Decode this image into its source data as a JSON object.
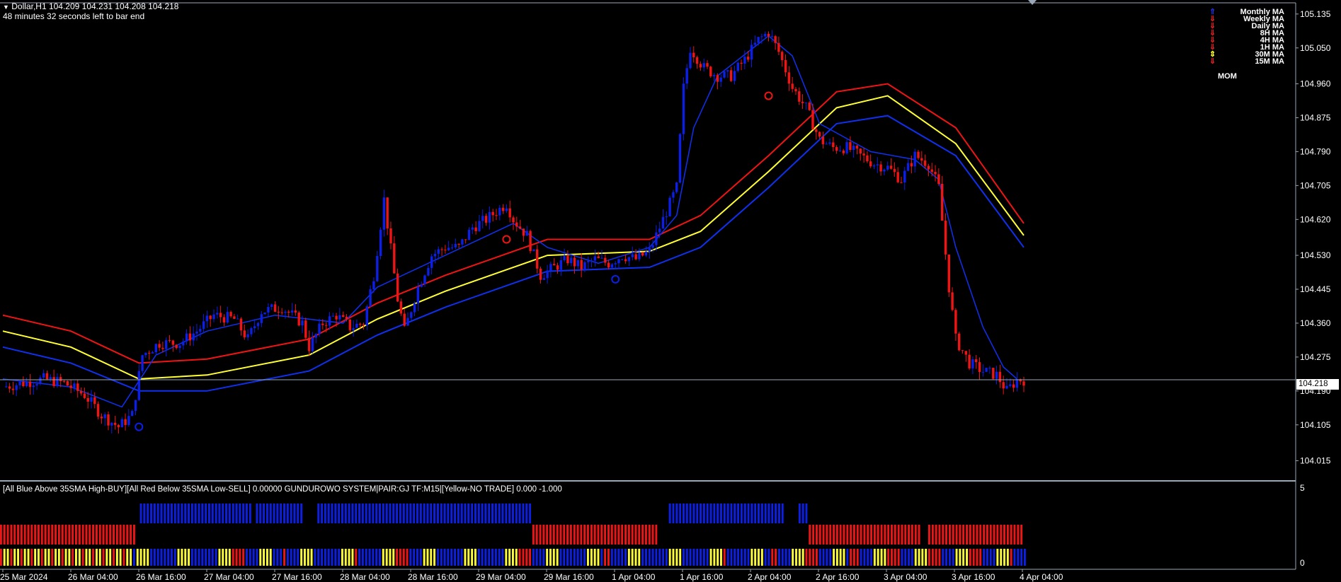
{
  "header": {
    "symbol_line": "Dollar,H1  104.209 104.231 104.208 104.218",
    "timer_line": "48 minutes 32 seconds left to bar end"
  },
  "ma_legend": [
    {
      "label": "Monthly MA",
      "arrow": "up",
      "color": "#2030e0"
    },
    {
      "label": "Weekly MA",
      "arrow": "down",
      "color": "#e02020"
    },
    {
      "label": "Daily MA",
      "arrow": "down",
      "color": "#e02020"
    },
    {
      "label": "8H MA",
      "arrow": "down",
      "color": "#e02020"
    },
    {
      "label": "4H MA",
      "arrow": "down",
      "color": "#e02020"
    },
    {
      "label": "1H MA",
      "arrow": "down",
      "color": "#e02020"
    },
    {
      "label": "30M MA",
      "arrow": "updown",
      "color": "#ffff20"
    },
    {
      "label": "15M MA",
      "arrow": "down",
      "color": "#e02020"
    }
  ],
  "mom_label": "MOM",
  "current_price": "104.218",
  "subwindow": {
    "title": "[All Blue Above 35SMA High-BUY][All Red Below 35SMA Low-SELL] 0.00000  GUNDUROWO SYSTEM|PAIR:GJ TF:M15|[Yellow-NO TRADE] 0.000 -1.000",
    "axis_top": "5",
    "axis_bottom": "0"
  },
  "colors": {
    "bull": "#0b1fe6",
    "bear": "#f01414",
    "ma_mid": "#ffff33",
    "ma_band": "#f01414",
    "ma_low": "#1030f0",
    "grid_line": "#9aa7b8"
  },
  "chart_data": {
    "type": "candlestick",
    "y_ticks": [
      "105.135",
      "105.050",
      "104.960",
      "104.875",
      "104.790",
      "104.705",
      "104.620",
      "104.530",
      "104.445",
      "104.360",
      "104.275",
      "104.190",
      "104.105",
      "104.015"
    ],
    "ylim": [
      104.0,
      105.14
    ],
    "x_ticks": [
      "25 Mar 2024",
      "26 Mar 04:00",
      "26 Mar 16:00",
      "27 Mar 04:00",
      "27 Mar 16:00",
      "28 Mar 04:00",
      "28 Mar 16:00",
      "29 Mar 04:00",
      "29 Mar 16:00",
      "1 Apr 04:00",
      "1 Apr 16:00",
      "2 Apr 04:00",
      "2 Apr 16:00",
      "3 Apr 04:00",
      "3 Apr 16:00",
      "4 Apr 04:00"
    ],
    "close_path": [
      [
        0,
        104.2
      ],
      [
        12,
        104.22
      ],
      [
        18,
        104.21
      ],
      [
        24,
        104.18
      ],
      [
        29,
        104.13
      ],
      [
        34,
        104.1
      ],
      [
        38,
        104.13
      ],
      [
        41,
        104.28
      ],
      [
        46,
        104.31
      ],
      [
        52,
        104.31
      ],
      [
        57,
        104.34
      ],
      [
        62,
        104.38
      ],
      [
        68,
        104.37
      ],
      [
        72,
        104.32
      ],
      [
        76,
        104.39
      ],
      [
        82,
        104.4
      ],
      [
        88,
        104.36
      ],
      [
        90,
        104.3
      ],
      [
        94,
        104.36
      ],
      [
        98,
        104.38
      ],
      [
        102,
        104.35
      ],
      [
        106,
        104.36
      ],
      [
        109,
        104.48
      ],
      [
        112,
        104.67
      ],
      [
        116,
        104.42
      ],
      [
        118,
        104.34
      ],
      [
        122,
        104.45
      ],
      [
        126,
        104.53
      ],
      [
        130,
        104.55
      ],
      [
        134,
        104.55
      ],
      [
        138,
        104.6
      ],
      [
        142,
        104.62
      ],
      [
        148,
        104.66
      ],
      [
        150,
        104.62
      ],
      [
        154,
        104.58
      ],
      [
        158,
        104.48
      ],
      [
        162,
        104.5
      ],
      [
        166,
        104.52
      ],
      [
        170,
        104.5
      ],
      [
        174,
        104.52
      ],
      [
        178,
        104.51
      ],
      [
        182,
        104.53
      ],
      [
        186,
        104.52
      ],
      [
        190,
        104.54
      ],
      [
        194,
        104.62
      ],
      [
        198,
        104.7
      ],
      [
        200,
        104.95
      ],
      [
        202,
        105.05
      ],
      [
        206,
        105.0
      ],
      [
        210,
        104.98
      ],
      [
        214,
        104.98
      ],
      [
        218,
        105.02
      ],
      [
        222,
        105.07
      ],
      [
        225,
        105.09
      ],
      [
        228,
        105.04
      ],
      [
        232,
        104.95
      ],
      [
        236,
        104.9
      ],
      [
        240,
        104.82
      ],
      [
        244,
        104.8
      ],
      [
        248,
        104.8
      ],
      [
        252,
        104.78
      ],
      [
        256,
        104.76
      ],
      [
        260,
        104.75
      ],
      [
        264,
        104.72
      ],
      [
        268,
        104.78
      ],
      [
        272,
        104.76
      ],
      [
        275,
        104.7
      ],
      [
        278,
        104.45
      ],
      [
        280,
        104.32
      ],
      [
        284,
        104.26
      ],
      [
        288,
        104.24
      ],
      [
        292,
        104.23
      ],
      [
        295,
        104.19
      ],
      [
        298,
        104.218
      ]
    ],
    "ma_lines": [
      {
        "name": "upper",
        "color": "#f01414",
        "points": [
          [
            0,
            104.38
          ],
          [
            20,
            104.34
          ],
          [
            40,
            104.26
          ],
          [
            60,
            104.27
          ],
          [
            90,
            104.32
          ],
          [
            110,
            104.41
          ],
          [
            130,
            104.48
          ],
          [
            160,
            104.57
          ],
          [
            190,
            104.57
          ],
          [
            205,
            104.63
          ],
          [
            225,
            104.78
          ],
          [
            245,
            104.94
          ],
          [
            260,
            104.96
          ],
          [
            280,
            104.85
          ],
          [
            300,
            104.61
          ]
        ]
      },
      {
        "name": "middle",
        "color": "#ffff33",
        "points": [
          [
            0,
            104.34
          ],
          [
            20,
            104.3
          ],
          [
            40,
            104.22
          ],
          [
            60,
            104.23
          ],
          [
            90,
            104.28
          ],
          [
            110,
            104.37
          ],
          [
            130,
            104.44
          ],
          [
            160,
            104.53
          ],
          [
            190,
            104.54
          ],
          [
            205,
            104.59
          ],
          [
            225,
            104.74
          ],
          [
            245,
            104.9
          ],
          [
            260,
            104.93
          ],
          [
            280,
            104.81
          ],
          [
            300,
            104.58
          ]
        ]
      },
      {
        "name": "lower",
        "color": "#1030f0",
        "points": [
          [
            0,
            104.3
          ],
          [
            20,
            104.26
          ],
          [
            40,
            104.19
          ],
          [
            60,
            104.19
          ],
          [
            90,
            104.24
          ],
          [
            110,
            104.33
          ],
          [
            130,
            104.4
          ],
          [
            160,
            104.49
          ],
          [
            190,
            104.5
          ],
          [
            205,
            104.55
          ],
          [
            225,
            104.7
          ],
          [
            245,
            104.86
          ],
          [
            260,
            104.88
          ],
          [
            280,
            104.78
          ],
          [
            300,
            104.55
          ]
        ]
      }
    ],
    "fast_line": [
      [
        0,
        104.22
      ],
      [
        20,
        104.2
      ],
      [
        35,
        104.15
      ],
      [
        45,
        104.28
      ],
      [
        60,
        104.34
      ],
      [
        80,
        104.38
      ],
      [
        100,
        104.36
      ],
      [
        110,
        104.45
      ],
      [
        120,
        104.49
      ],
      [
        135,
        104.55
      ],
      [
        150,
        104.61
      ],
      [
        160,
        104.55
      ],
      [
        175,
        104.51
      ],
      [
        190,
        104.55
      ],
      [
        198,
        104.63
      ],
      [
        203,
        104.85
      ],
      [
        210,
        104.98
      ],
      [
        225,
        105.08
      ],
      [
        232,
        105.03
      ],
      [
        240,
        104.86
      ],
      [
        255,
        104.79
      ],
      [
        268,
        104.77
      ],
      [
        275,
        104.72
      ],
      [
        280,
        104.55
      ],
      [
        288,
        104.35
      ],
      [
        294,
        104.25
      ],
      [
        298,
        104.22
      ]
    ],
    "subwindow_rows": {
      "row_blue": [
        [
          41,
          73
        ],
        [
          75,
          88
        ],
        [
          93,
          118
        ],
        [
          119,
          155
        ],
        [
          196,
          229
        ],
        [
          234,
          236
        ]
      ],
      "row_red": [
        [
          0,
          39
        ],
        [
          156,
          192
        ],
        [
          237,
          269
        ],
        [
          272,
          299
        ]
      ],
      "row_mixed_pattern": "blue-yellow alternating"
    }
  }
}
